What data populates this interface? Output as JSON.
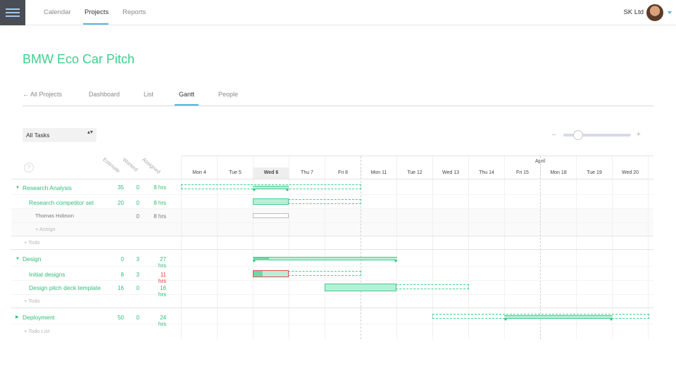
{
  "topnav": {
    "items": [
      {
        "label": "Calendar"
      },
      {
        "label": "Projects"
      },
      {
        "label": "Reports"
      }
    ],
    "org": "SK Ltd"
  },
  "project": {
    "title": "BMW Eco Car Pitch",
    "tabs": [
      {
        "label": "← All Projects"
      },
      {
        "label": "Dashboard"
      },
      {
        "label": "List"
      },
      {
        "label": "Gantt"
      },
      {
        "label": "People"
      }
    ]
  },
  "filter": {
    "value": "All Tasks",
    "arrows": "▴▾"
  },
  "zoom": {
    "minus": "–",
    "plus": "+",
    "level": 0.22
  },
  "columns": {
    "help": "?",
    "estimate": "Estimate",
    "worked": "Worked",
    "assigned": "Assigned"
  },
  "timeline": {
    "month": "April",
    "days": [
      "Mon 4",
      "Tue 5",
      "Wed 6",
      "Thu 7",
      "Fri 8",
      "Mon 11",
      "Tue 12",
      "Wed 13",
      "Thu 14",
      "Fri 15",
      "Mon 18",
      "Tue 19",
      "Wed 20"
    ],
    "today": "Wed 6"
  },
  "rows": {
    "research": {
      "label": "Research Analysis",
      "estimate": "35",
      "worked": "0",
      "assigned": "8 hrs"
    },
    "competitor": {
      "label": "Research competitor set",
      "estimate": "20",
      "worked": "0",
      "assigned": "8 hrs"
    },
    "thomas": {
      "label": "Thomas Hobson",
      "worked": "0",
      "assigned": "8 hrs"
    },
    "assign": "+ Assign",
    "todo1": "+ Todo",
    "design": {
      "label": "Design",
      "estimate": "0",
      "worked": "3",
      "assigned": "27 hrs"
    },
    "initial": {
      "label": "Initial designs",
      "estimate": "8",
      "worked": "3",
      "assigned": "11 hrs"
    },
    "template": {
      "label": "Design pitch deck template",
      "estimate": "16",
      "worked": "0",
      "assigned": "16 hrs"
    },
    "todo2": "+ Todo",
    "deployment": {
      "label": "Deployment",
      "estimate": "50",
      "worked": "0",
      "assigned": "24 hrs"
    },
    "todolist": "+ Todo List"
  },
  "colors": {
    "accent": "#3ecf8e",
    "link": "#56b4de",
    "over": "#e03a3a"
  }
}
